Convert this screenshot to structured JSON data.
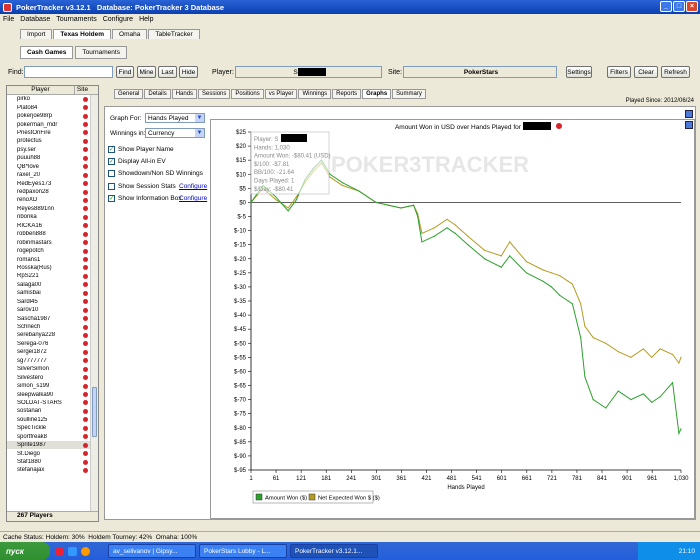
{
  "title": {
    "app": "PokerTracker v3.12.1",
    "db_label": "Database: PokerTracker 3 Database"
  },
  "menu": [
    "File",
    "Database",
    "Tournaments",
    "Configure",
    "Help"
  ],
  "game_tabs": [
    "Import",
    "Texas Holdem",
    "Omaha",
    "TableTracker"
  ],
  "sub_tabs": [
    "Cash Games",
    "Tournaments"
  ],
  "filter": {
    "find_label": "Find:",
    "find_value": "",
    "buttons": [
      "Find",
      "Mine",
      "Last",
      "Hide"
    ],
    "player_label": "Player:",
    "player_value": "S",
    "site_label": "Site:",
    "site_value": "PokerStars",
    "settings": "Settings",
    "filters": "Filters",
    "clear": "Clear",
    "refresh": "Refresh"
  },
  "player_list": {
    "header_player": "Player",
    "header_site": "Site",
    "count": "267 Players",
    "players": [
      "pirko",
      "Plato84",
      "pokerjoe98rp",
      "pokerman_mdr",
      "PriestOnFire",
      "protectus",
      "psy.ser",
      "puuuh88",
      "QB*love",
      "raxel_20",
      "RedEyes173",
      "redpaxon28",
      "renoXD",
      "Reyes8891nn",
      "ribonka",
      "RICKA16",
      "robben888",
      "robinmastars",
      "rogepotch",
      "romans1",
      "Rosska(Rus)",
      "RpS221",
      "salaga00",
      "samisbai",
      "Sardl45",
      "sarov10",
      "Sascha1987",
      "Schnech",
      "serebanya228",
      "Serega-076",
      "sergei1872",
      "sg7777777",
      "SilverSimon",
      "Silvestero",
      "simon_s199",
      "sleepwalka90",
      "SOLDAT-STARS",
      "sostanan",
      "soulline125",
      "SpecTickle",
      "sportfreak8",
      "Sprite1987",
      "St.Diego",
      "Staf1880",
      "stefanajax"
    ],
    "selected": "Sprite1987"
  },
  "stat_tabs": [
    "General",
    "Details",
    "Hands",
    "Sessions",
    "Positions",
    "vs Player",
    "Winnings",
    "Reports",
    "Graphs",
    "Summary"
  ],
  "active_stat_tab": "Graphs",
  "played_since": "Played Since: 2012/06/24",
  "graph_controls": {
    "graph_for_label": "Graph For:",
    "graph_for_value": "Hands Played",
    "winnings_label": "Winnings in:",
    "winnings_value": "Currency",
    "checkboxes": [
      {
        "label": "Show Player Name",
        "checked": true
      },
      {
        "label": "Display All-in EV",
        "checked": true
      },
      {
        "label": "Showdown/Non SD Winnings",
        "checked": false
      },
      {
        "label": "Show Session Stats",
        "checked": false
      },
      {
        "label": "Show Information Box",
        "checked": true
      }
    ],
    "configure": "Configure"
  },
  "info_box": {
    "player": "Player: S",
    "hands": "Hands: 1,030",
    "amount_won": "Amount Won: -$80.41 (USD)",
    "per100": "$/100: -$7.81",
    "bb100": "BB/100: -21.64",
    "days_played": "Days Played: 1",
    "per_day": "$/Day: -$80.41"
  },
  "watermark": "POKER3TRACKER",
  "chart_data": {
    "type": "line",
    "title": "Amount Won in USD over Hands Played for S",
    "xlabel": "Hands Played",
    "ylabel": "",
    "xlim": [
      1,
      1030
    ],
    "ylim": [
      -95,
      25
    ],
    "x_ticks": [
      "1",
      "61",
      "121",
      "181",
      "241",
      "301",
      "361",
      "421",
      "481",
      "541",
      "601",
      "661",
      "721",
      "781",
      "841",
      "901",
      "961",
      "1,030"
    ],
    "y_ticks": [
      "$25",
      "$20",
      "$15",
      "$10",
      "$5",
      "$0",
      "$-5",
      "$-10",
      "$-15",
      "$-20",
      "$-25",
      "$-30",
      "$-35",
      "$-40",
      "$-45",
      "$-50",
      "$-55",
      "$-60",
      "$-65",
      "$-70",
      "$-75",
      "$-80",
      "$-85",
      "$-90",
      "$-95"
    ],
    "grid": false,
    "legend_position": "bottom-left",
    "series": [
      {
        "name": "Amount Won ($)",
        "color": "#2ca02c",
        "points": [
          [
            1,
            0
          ],
          [
            30,
            6
          ],
          [
            60,
            2
          ],
          [
            90,
            -3
          ],
          [
            110,
            1
          ],
          [
            130,
            8
          ],
          [
            150,
            12
          ],
          [
            170,
            15
          ],
          [
            190,
            10
          ],
          [
            220,
            7
          ],
          [
            260,
            4
          ],
          [
            300,
            0
          ],
          [
            330,
            -1
          ],
          [
            360,
            -2
          ],
          [
            390,
            -1
          ],
          [
            400,
            -5
          ],
          [
            410,
            -14
          ],
          [
            440,
            -12
          ],
          [
            470,
            -9
          ],
          [
            490,
            -11
          ],
          [
            520,
            -15
          ],
          [
            560,
            -20
          ],
          [
            600,
            -23
          ],
          [
            620,
            -19
          ],
          [
            660,
            -25
          ],
          [
            700,
            -28
          ],
          [
            720,
            -30
          ],
          [
            740,
            -33
          ],
          [
            760,
            -35
          ],
          [
            770,
            -36
          ],
          [
            790,
            -48
          ],
          [
            800,
            -62
          ],
          [
            820,
            -70
          ],
          [
            850,
            -73
          ],
          [
            880,
            -67
          ],
          [
            910,
            -70
          ],
          [
            940,
            -68
          ],
          [
            960,
            -71
          ],
          [
            980,
            -69
          ],
          [
            1010,
            -64
          ],
          [
            1025,
            -82
          ],
          [
            1030,
            -80.41
          ]
        ]
      },
      {
        "name": "Net Expected Won $ ($)",
        "color": "#b59a23",
        "points": [
          [
            1,
            0
          ],
          [
            30,
            5
          ],
          [
            60,
            1
          ],
          [
            90,
            -2
          ],
          [
            110,
            2
          ],
          [
            130,
            7
          ],
          [
            150,
            11
          ],
          [
            170,
            14
          ],
          [
            190,
            9
          ],
          [
            220,
            6
          ],
          [
            260,
            4
          ],
          [
            300,
            0
          ],
          [
            330,
            -1
          ],
          [
            360,
            -2
          ],
          [
            390,
            -1
          ],
          [
            400,
            -4
          ],
          [
            410,
            -11
          ],
          [
            440,
            -9
          ],
          [
            470,
            -6
          ],
          [
            490,
            -8
          ],
          [
            520,
            -12
          ],
          [
            560,
            -17
          ],
          [
            600,
            -19
          ],
          [
            620,
            -14
          ],
          [
            660,
            -21
          ],
          [
            700,
            -24
          ],
          [
            720,
            -25
          ],
          [
            740,
            -26
          ],
          [
            760,
            -28
          ],
          [
            770,
            -29
          ],
          [
            790,
            -36
          ],
          [
            800,
            -44
          ],
          [
            820,
            -48
          ],
          [
            850,
            -50
          ],
          [
            880,
            -53
          ],
          [
            910,
            -55
          ],
          [
            940,
            -52
          ],
          [
            960,
            -55
          ],
          [
            980,
            -52
          ],
          [
            1010,
            -54
          ],
          [
            1025,
            -57
          ],
          [
            1030,
            -55
          ]
        ]
      }
    ]
  },
  "status": {
    "cache": "Cache Status: Holdem: 30%",
    "holdem_tourney": "Holdem Tourney: 42%",
    "omaha": "Omaha: 100%"
  },
  "taskbar": {
    "start": "пуск",
    "items": [
      "av_selivanov | Gipsy...",
      "PokerStars Lobby - L...",
      "PokerTracker v3.12.1..."
    ],
    "clock": "21:10"
  }
}
